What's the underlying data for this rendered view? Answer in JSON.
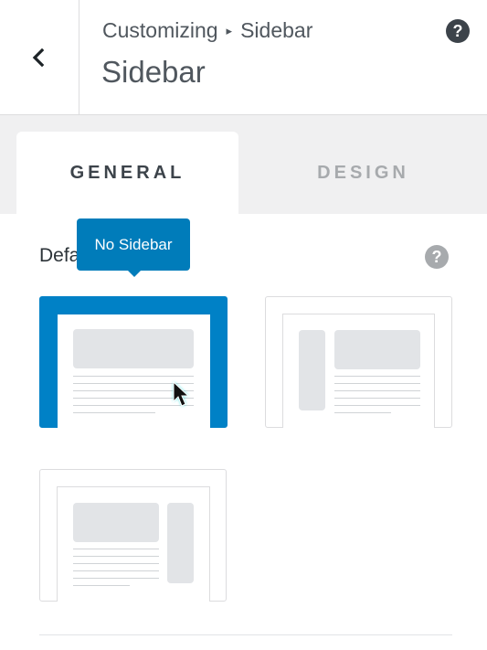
{
  "header": {
    "breadcrumb_parent": "Customizing",
    "breadcrumb_separator": "▸",
    "breadcrumb_current": "Sidebar",
    "title": "Sidebar",
    "back_icon": "chevron-left-icon",
    "help_icon": "question-mark-icon"
  },
  "tabs": [
    {
      "label": "GENERAL",
      "active": true
    },
    {
      "label": "DESIGN",
      "active": false
    }
  ],
  "field": {
    "label": "Default Layout",
    "help_icon": "question-mark-icon"
  },
  "tooltip": {
    "text": "No Sidebar"
  },
  "layouts": [
    {
      "name": "no-sidebar",
      "selected": true
    },
    {
      "name": "left-sidebar",
      "selected": false
    },
    {
      "name": "right-sidebar",
      "selected": false
    }
  ],
  "colors": {
    "accent": "#0081c6",
    "tooltip": "#007cba",
    "tabs_background": "#f0f0f1",
    "text": "#50575e"
  }
}
